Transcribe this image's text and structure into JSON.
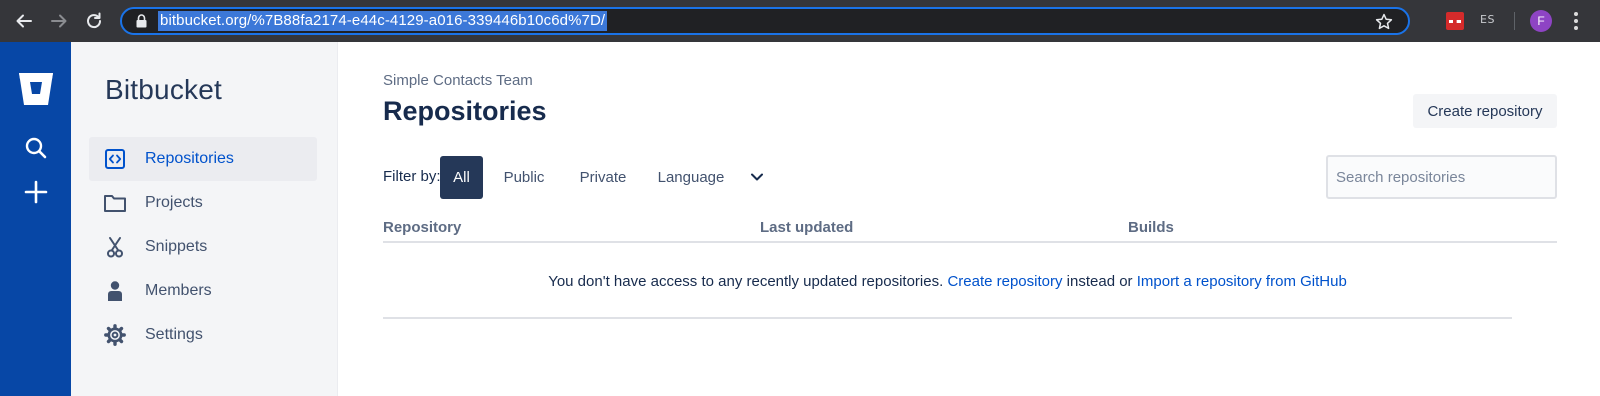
{
  "browser": {
    "url": "bitbucket.org/%7B88fa2174-e44c-4129-a016-339446b10c6d%7D/",
    "extension_label": "ES",
    "profile_initial": "F"
  },
  "global_nav": {
    "icons": [
      "bitbucket-logo",
      "search-icon",
      "plus-icon"
    ],
    "brand_color": "#0747a6"
  },
  "sidebar": {
    "title": "Bitbucket",
    "items": [
      {
        "label": "Repositories",
        "icon": "repository-icon",
        "active": true
      },
      {
        "label": "Projects",
        "icon": "folder-icon",
        "active": false
      },
      {
        "label": "Snippets",
        "icon": "scissors-icon",
        "active": false
      },
      {
        "label": "Members",
        "icon": "person-icon",
        "active": false
      },
      {
        "label": "Settings",
        "icon": "gear-icon",
        "active": false
      }
    ]
  },
  "main": {
    "team_name": "Simple Contacts Team",
    "title": "Repositories",
    "create_button": "Create repository",
    "filter": {
      "label": "Filter by:",
      "options": [
        "All",
        "Public",
        "Private"
      ],
      "selected": "All",
      "language_label": "Language"
    },
    "search": {
      "placeholder": "Search repositories",
      "value": ""
    },
    "table": {
      "columns": [
        "Repository",
        "Last updated",
        "Builds"
      ],
      "rows": []
    },
    "empty_state": {
      "text": "You don't have access to any recently updated repositories.",
      "create_link": "Create repository",
      "middle": "instead or",
      "import_link": "Import a repository from GitHub"
    }
  },
  "colors": {
    "link": "#0052cc",
    "selected_filter_bg": "#253858",
    "sidebar_bg": "#f4f5f7"
  }
}
